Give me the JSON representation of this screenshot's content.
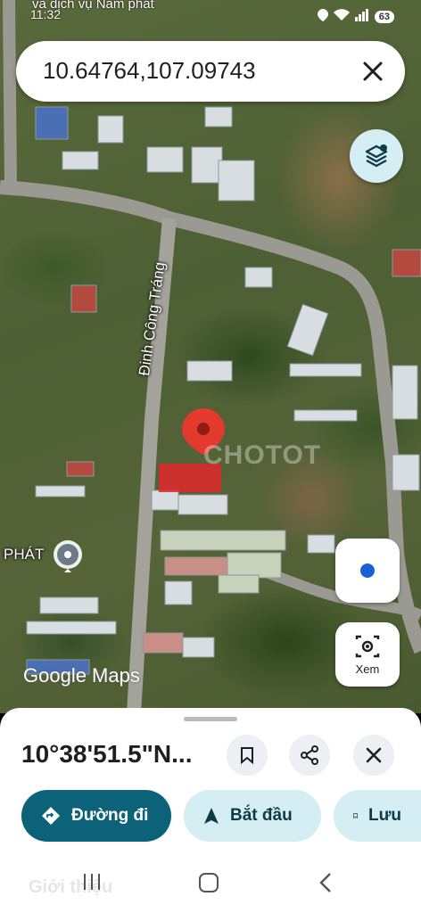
{
  "status_bar": {
    "app_title": "và dịch vụ Nam phát",
    "time": "11:32",
    "battery": "63"
  },
  "search": {
    "query": "10.64764,107.09743"
  },
  "map": {
    "street_label": "Đinh Công Tráng",
    "place_label": "PHÁT",
    "watermark": "CHOTOT",
    "attribution": "Google Maps"
  },
  "map_controls": {
    "lens_label": "Xem"
  },
  "sheet": {
    "coordinates": "10°38'51.5\"N...",
    "actions": [
      {
        "label": "Đường đi"
      },
      {
        "label": "Bắt đầu"
      },
      {
        "label": "Lưu"
      }
    ]
  },
  "nav_bar": {
    "faded_text": "Giới thiệu"
  },
  "colors": {
    "primary": "#0b6279",
    "secondary": "#d4eef3",
    "pin": "#e23b2e",
    "location_dot": "#1a5fd6"
  }
}
